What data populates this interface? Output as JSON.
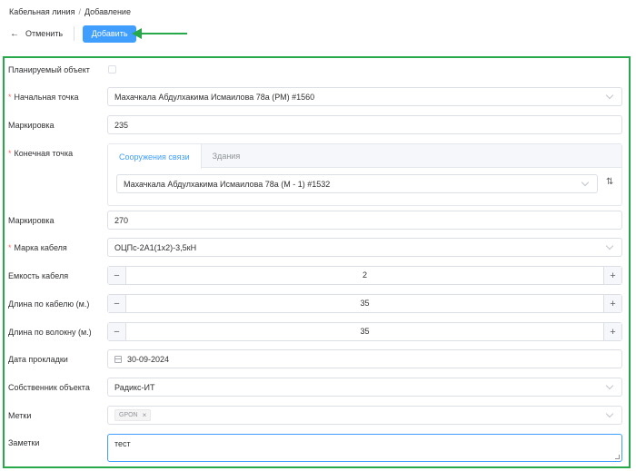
{
  "breadcrumb": {
    "parent": "Кабельная линия",
    "separator": "/",
    "current": "Добавление"
  },
  "toolbar": {
    "cancel_label": "Отменить",
    "add_label": "Добавить"
  },
  "colors": {
    "primary": "#409eff",
    "annotation": "#27a84a",
    "required": "#f56c6c"
  },
  "form": {
    "planned": {
      "label": "Планируемый объект",
      "checked": false
    },
    "start_point": {
      "label": "Начальная точка",
      "value": "Махачкала Абдулхакима Исмаилова 78а (РМ) #1560"
    },
    "marking1": {
      "label": "Маркировка",
      "value": "235"
    },
    "end_point": {
      "label": "Конечная точка",
      "tabs": [
        "Сооружения связи",
        "Здания"
      ],
      "value": "Махачкала Абдулхакима Исмаилова 78а (М - 1) #1532"
    },
    "marking2": {
      "label": "Маркировка",
      "value": "270"
    },
    "cable_brand": {
      "label": "Марка кабеля",
      "value": "ОЦПс-2А1(1х2)-3,5кН"
    },
    "cable_capacity": {
      "label": "Емкость кабеля",
      "value": "2"
    },
    "cable_length": {
      "label": "Длина по кабелю (м.)",
      "value": "35"
    },
    "fiber_length": {
      "label": "Длина по волокну (м.)",
      "value": "35"
    },
    "lay_date": {
      "label": "Дата прокладки",
      "value": "30-09-2024"
    },
    "owner": {
      "label": "Собственник объекта",
      "value": "Радикс-ИТ"
    },
    "tags": {
      "label": "Метки",
      "items": [
        "GPON"
      ]
    },
    "notes": {
      "label": "Заметки",
      "value": "тест"
    }
  }
}
